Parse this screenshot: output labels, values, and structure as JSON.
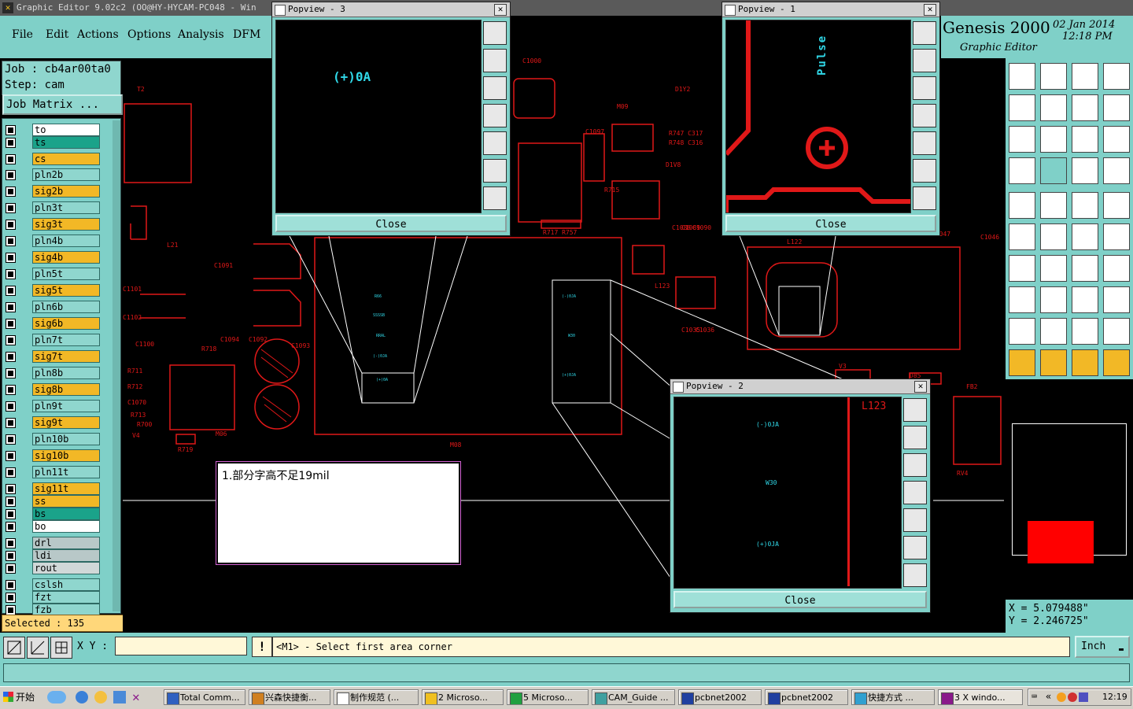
{
  "titlebar": {
    "text": "Graphic Editor 9.02c2  (OO@HY-HYCAM-PC048 - Win"
  },
  "menu": [
    "File",
    "Edit",
    "Actions",
    "Options",
    "Analysis",
    "DFM"
  ],
  "job": {
    "job_line": "Job : cb4ar00ta0",
    "step_line": "Step: cam",
    "matrix_button": "Job Matrix ..."
  },
  "layers": [
    {
      "name": "to",
      "color": "#ffffff"
    },
    {
      "name": "ts",
      "color": "#1aa38a"
    },
    {
      "name": "cs",
      "color": "#f2b826"
    },
    {
      "name": "pln2b",
      "color": "#8fd6ce"
    },
    {
      "name": "sig2b",
      "color": "#f2b826"
    },
    {
      "name": "pln3t",
      "color": "#8fd6ce"
    },
    {
      "name": "sig3t",
      "color": "#f2b826"
    },
    {
      "name": "pln4b",
      "color": "#8fd6ce"
    },
    {
      "name": "sig4b",
      "color": "#f2b826"
    },
    {
      "name": "pln5t",
      "color": "#8fd6ce"
    },
    {
      "name": "sig5t",
      "color": "#f2b826"
    },
    {
      "name": "pln6b",
      "color": "#8fd6ce"
    },
    {
      "name": "sig6b",
      "color": "#f2b826"
    },
    {
      "name": "pln7t",
      "color": "#8fd6ce"
    },
    {
      "name": "sig7t",
      "color": "#f2b826"
    },
    {
      "name": "pln8b",
      "color": "#8fd6ce"
    },
    {
      "name": "sig8b",
      "color": "#f2b826"
    },
    {
      "name": "pln9t",
      "color": "#8fd6ce"
    },
    {
      "name": "sig9t",
      "color": "#f2b826"
    },
    {
      "name": "pln10b",
      "color": "#8fd6ce"
    },
    {
      "name": "sig10b",
      "color": "#f2b826"
    },
    {
      "name": "pln11t",
      "color": "#8fd6ce"
    },
    {
      "name": "sig11t",
      "color": "#f2b826"
    },
    {
      "name": "ss",
      "color": "#f2b826"
    },
    {
      "name": "bs",
      "color": "#1aa38a"
    },
    {
      "name": "bo",
      "color": "#ffffff"
    },
    {
      "name": "drl",
      "color": "#b8c8c8"
    },
    {
      "name": "ldi",
      "color": "#b8c8c8"
    },
    {
      "name": "rout",
      "color": "#d0d8d8"
    },
    {
      "name": "cslsh",
      "color": "#8fd6ce"
    },
    {
      "name": "fzt",
      "color": "#8fd6ce"
    },
    {
      "name": "fzb",
      "color": "#8fd6ce"
    }
  ],
  "selected": "Selected : 135",
  "brand": {
    "name": "Genesis 2000",
    "subtitle": "Graphic Editor",
    "date": "02 Jan 2014",
    "time": "12:18 PM"
  },
  "coords": {
    "x": "X = 5.079488\"",
    "y": "Y = 2.246725\""
  },
  "status": {
    "xy_label": "X Y :",
    "xy_value": "",
    "message": "<M1> - Select first area corner",
    "units": "Inch"
  },
  "popups": [
    {
      "title": "Popview - 3",
      "close": "Close",
      "text": "(+)0A"
    },
    {
      "title": "Popview - 1",
      "close": "Close",
      "text": "Pulse"
    },
    {
      "title": "Popview - 2",
      "close": "Close",
      "text": "L123",
      "small1": "(-)0JA",
      "small2": "W30",
      "small3": "(+)0JA"
    }
  ],
  "note": "1.部分字高不足19mil",
  "canvas_labels": [
    "T2",
    "C1000",
    "D1Y2",
    "M09",
    "C1097",
    "R747 C317",
    "R748 C316",
    "D1V8",
    "R715",
    "R717 R757",
    "C1088",
    "C1089",
    "C1090",
    "C1091",
    "C1101",
    "C1102",
    "C1100",
    "C1094",
    "C1092",
    "R718",
    "C1093",
    "R719",
    "M06",
    "R700",
    "V4",
    "C1070",
    "R713",
    "R712",
    "R711",
    "L21",
    "L123",
    "C1035",
    "C1036",
    "C1046",
    "L122",
    "C1047",
    "V3",
    "D85",
    "FB2",
    "RV4",
    "M08"
  ],
  "taskbar": {
    "start": "开始",
    "tasks": [
      "Total Comm...",
      "兴森快捷衡...",
      "制作规范 (...",
      "2 Microso...",
      "5 Microso...",
      "CAM_Guide ...",
      "pcbnet2002",
      "pcbnet2002",
      "快捷方式 ...",
      "3 X windo..."
    ],
    "clock": "12:19"
  },
  "colors": {
    "teal": "#7fd0c8",
    "pcb_red": "#e01818",
    "cyan_text": "#30d8e8",
    "yellow": "#f2b826"
  }
}
